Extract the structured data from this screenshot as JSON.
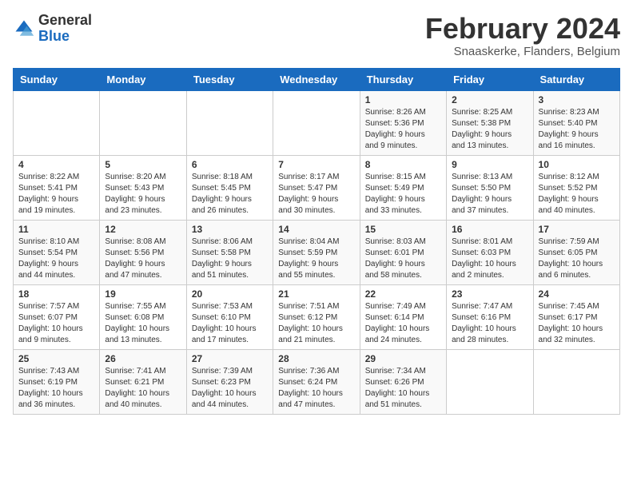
{
  "header": {
    "logo_general": "General",
    "logo_blue": "Blue",
    "month_year": "February 2024",
    "location": "Snaaskerke, Flanders, Belgium"
  },
  "weekdays": [
    "Sunday",
    "Monday",
    "Tuesday",
    "Wednesday",
    "Thursday",
    "Friday",
    "Saturday"
  ],
  "weeks": [
    [
      {
        "day": "",
        "info": ""
      },
      {
        "day": "",
        "info": ""
      },
      {
        "day": "",
        "info": ""
      },
      {
        "day": "",
        "info": ""
      },
      {
        "day": "1",
        "info": "Sunrise: 8:26 AM\nSunset: 5:36 PM\nDaylight: 9 hours\nand 9 minutes."
      },
      {
        "day": "2",
        "info": "Sunrise: 8:25 AM\nSunset: 5:38 PM\nDaylight: 9 hours\nand 13 minutes."
      },
      {
        "day": "3",
        "info": "Sunrise: 8:23 AM\nSunset: 5:40 PM\nDaylight: 9 hours\nand 16 minutes."
      }
    ],
    [
      {
        "day": "4",
        "info": "Sunrise: 8:22 AM\nSunset: 5:41 PM\nDaylight: 9 hours\nand 19 minutes."
      },
      {
        "day": "5",
        "info": "Sunrise: 8:20 AM\nSunset: 5:43 PM\nDaylight: 9 hours\nand 23 minutes."
      },
      {
        "day": "6",
        "info": "Sunrise: 8:18 AM\nSunset: 5:45 PM\nDaylight: 9 hours\nand 26 minutes."
      },
      {
        "day": "7",
        "info": "Sunrise: 8:17 AM\nSunset: 5:47 PM\nDaylight: 9 hours\nand 30 minutes."
      },
      {
        "day": "8",
        "info": "Sunrise: 8:15 AM\nSunset: 5:49 PM\nDaylight: 9 hours\nand 33 minutes."
      },
      {
        "day": "9",
        "info": "Sunrise: 8:13 AM\nSunset: 5:50 PM\nDaylight: 9 hours\nand 37 minutes."
      },
      {
        "day": "10",
        "info": "Sunrise: 8:12 AM\nSunset: 5:52 PM\nDaylight: 9 hours\nand 40 minutes."
      }
    ],
    [
      {
        "day": "11",
        "info": "Sunrise: 8:10 AM\nSunset: 5:54 PM\nDaylight: 9 hours\nand 44 minutes."
      },
      {
        "day": "12",
        "info": "Sunrise: 8:08 AM\nSunset: 5:56 PM\nDaylight: 9 hours\nand 47 minutes."
      },
      {
        "day": "13",
        "info": "Sunrise: 8:06 AM\nSunset: 5:58 PM\nDaylight: 9 hours\nand 51 minutes."
      },
      {
        "day": "14",
        "info": "Sunrise: 8:04 AM\nSunset: 5:59 PM\nDaylight: 9 hours\nand 55 minutes."
      },
      {
        "day": "15",
        "info": "Sunrise: 8:03 AM\nSunset: 6:01 PM\nDaylight: 9 hours\nand 58 minutes."
      },
      {
        "day": "16",
        "info": "Sunrise: 8:01 AM\nSunset: 6:03 PM\nDaylight: 10 hours\nand 2 minutes."
      },
      {
        "day": "17",
        "info": "Sunrise: 7:59 AM\nSunset: 6:05 PM\nDaylight: 10 hours\nand 6 minutes."
      }
    ],
    [
      {
        "day": "18",
        "info": "Sunrise: 7:57 AM\nSunset: 6:07 PM\nDaylight: 10 hours\nand 9 minutes."
      },
      {
        "day": "19",
        "info": "Sunrise: 7:55 AM\nSunset: 6:08 PM\nDaylight: 10 hours\nand 13 minutes."
      },
      {
        "day": "20",
        "info": "Sunrise: 7:53 AM\nSunset: 6:10 PM\nDaylight: 10 hours\nand 17 minutes."
      },
      {
        "day": "21",
        "info": "Sunrise: 7:51 AM\nSunset: 6:12 PM\nDaylight: 10 hours\nand 21 minutes."
      },
      {
        "day": "22",
        "info": "Sunrise: 7:49 AM\nSunset: 6:14 PM\nDaylight: 10 hours\nand 24 minutes."
      },
      {
        "day": "23",
        "info": "Sunrise: 7:47 AM\nSunset: 6:16 PM\nDaylight: 10 hours\nand 28 minutes."
      },
      {
        "day": "24",
        "info": "Sunrise: 7:45 AM\nSunset: 6:17 PM\nDaylight: 10 hours\nand 32 minutes."
      }
    ],
    [
      {
        "day": "25",
        "info": "Sunrise: 7:43 AM\nSunset: 6:19 PM\nDaylight: 10 hours\nand 36 minutes."
      },
      {
        "day": "26",
        "info": "Sunrise: 7:41 AM\nSunset: 6:21 PM\nDaylight: 10 hours\nand 40 minutes."
      },
      {
        "day": "27",
        "info": "Sunrise: 7:39 AM\nSunset: 6:23 PM\nDaylight: 10 hours\nand 44 minutes."
      },
      {
        "day": "28",
        "info": "Sunrise: 7:36 AM\nSunset: 6:24 PM\nDaylight: 10 hours\nand 47 minutes."
      },
      {
        "day": "29",
        "info": "Sunrise: 7:34 AM\nSunset: 6:26 PM\nDaylight: 10 hours\nand 51 minutes."
      },
      {
        "day": "",
        "info": ""
      },
      {
        "day": "",
        "info": ""
      }
    ]
  ]
}
